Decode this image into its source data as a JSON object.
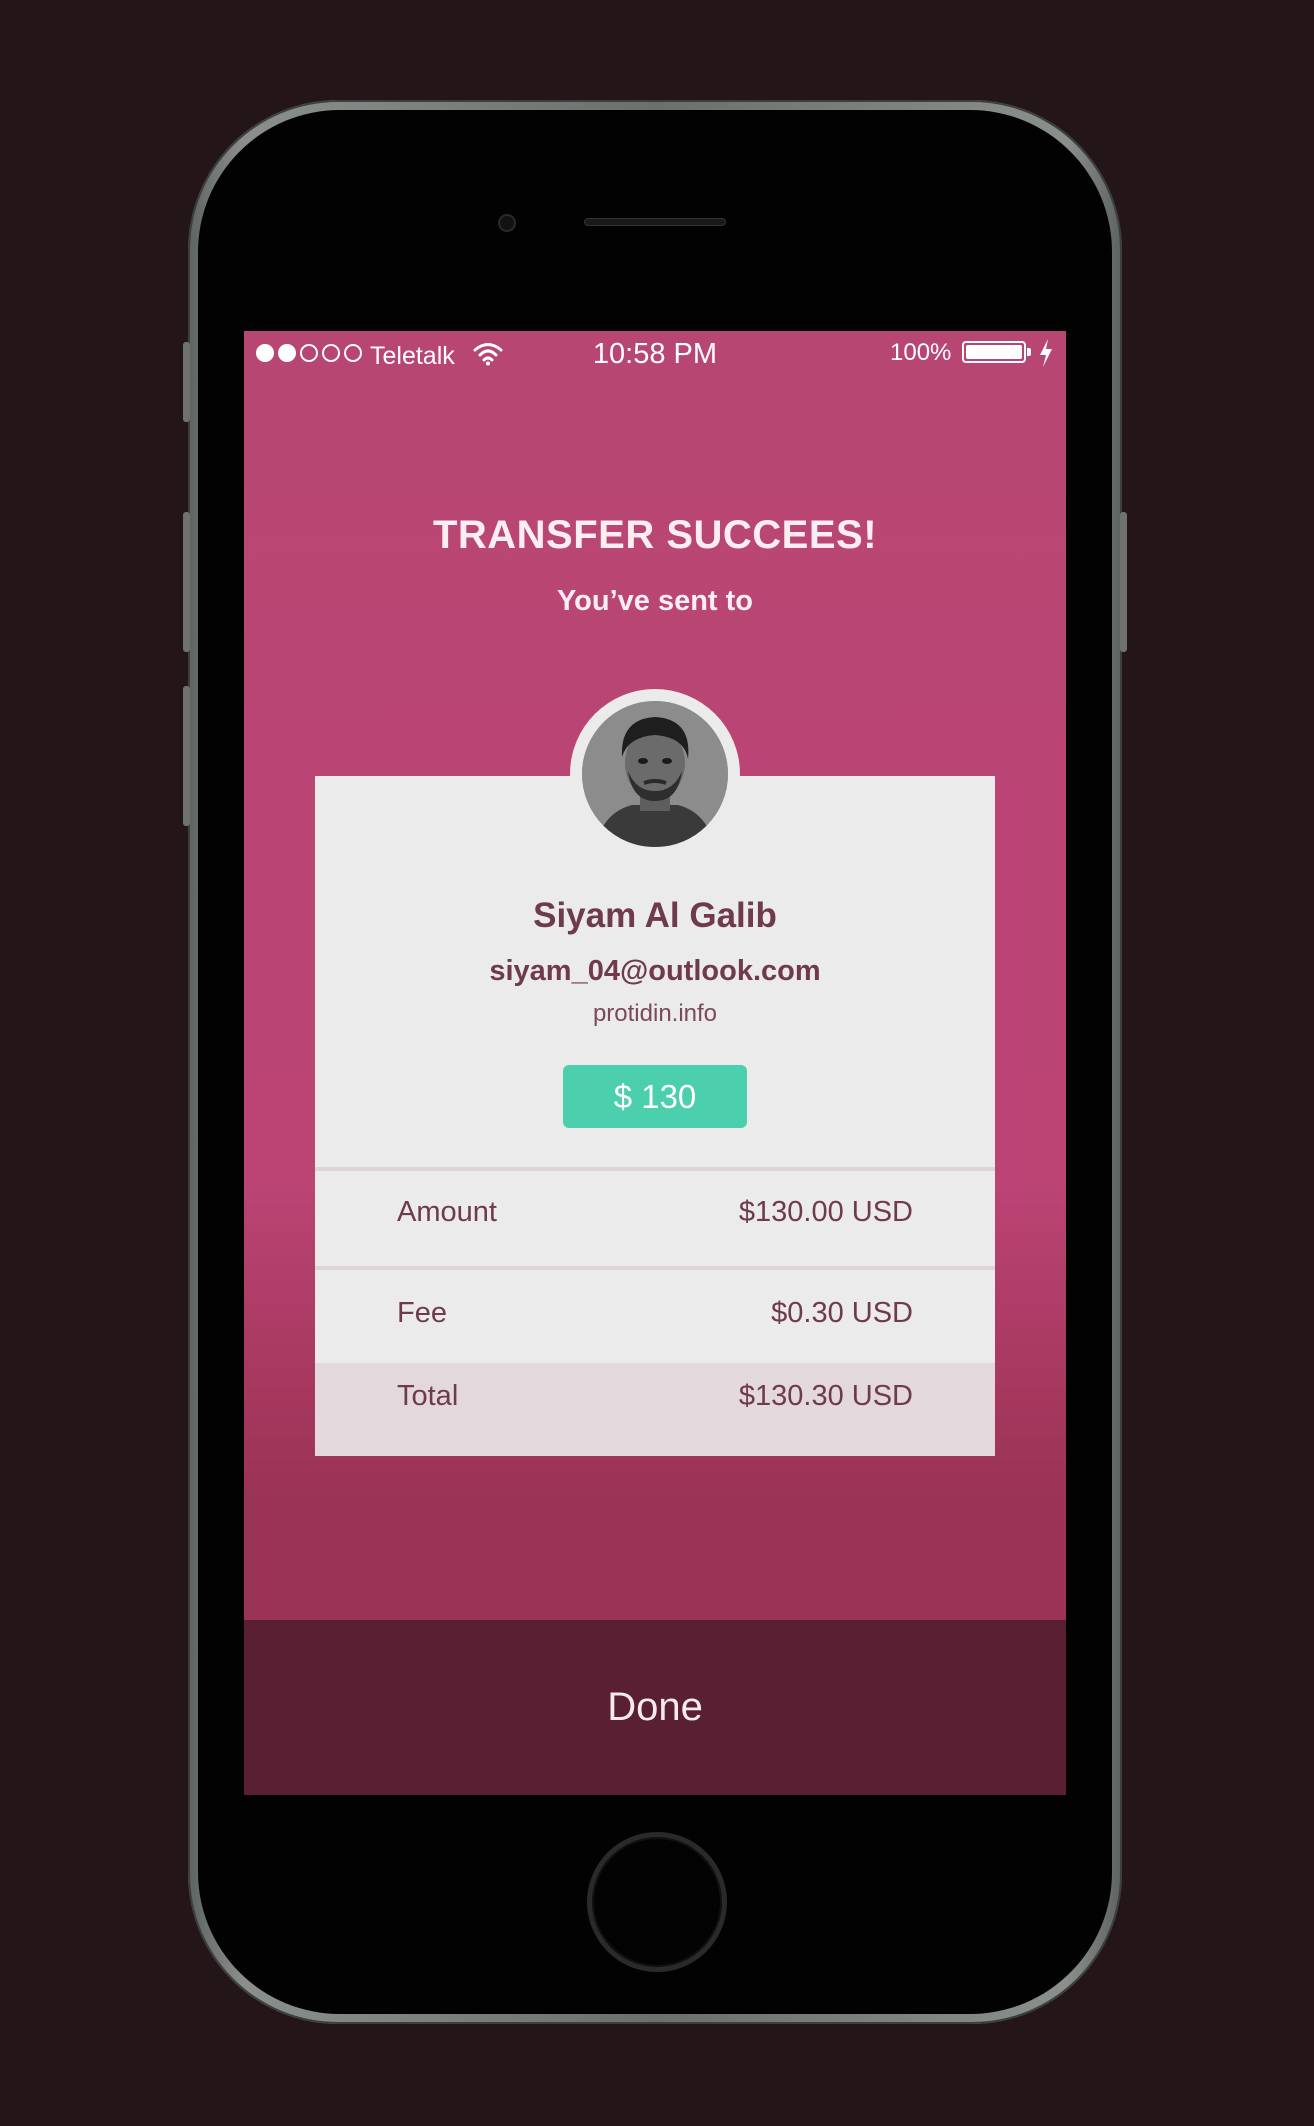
{
  "status_bar": {
    "carrier": "Teletalk",
    "time": "10:58 PM",
    "battery_percent": "100%",
    "signal_strength_bars": 2,
    "signal_total_bars": 5
  },
  "header": {
    "title": "TRANSFER SUCCEES!",
    "subtitle": "You’ve sent to"
  },
  "recipient": {
    "name": "Siyam Al Galib",
    "email": "siyam_04@outlook.com",
    "website": "protidin.info"
  },
  "amount_badge": "$ 130",
  "summary": {
    "amount_label": "Amount",
    "amount_value": "$130.00 USD",
    "fee_label": "Fee",
    "fee_value": "$0.30 USD",
    "total_label": "Total",
    "total_value": "$130.30 USD"
  },
  "done_label": "Done",
  "colors": {
    "accent_pink": "#b84673",
    "badge_green": "#4ccfac",
    "done_background": "#591f33",
    "card_background": "#ebebeb",
    "text_plum": "#6e3a4c"
  },
  "icons": [
    "wifi-icon",
    "battery-icon",
    "charging-bolt-icon",
    "avatar-photo"
  ]
}
